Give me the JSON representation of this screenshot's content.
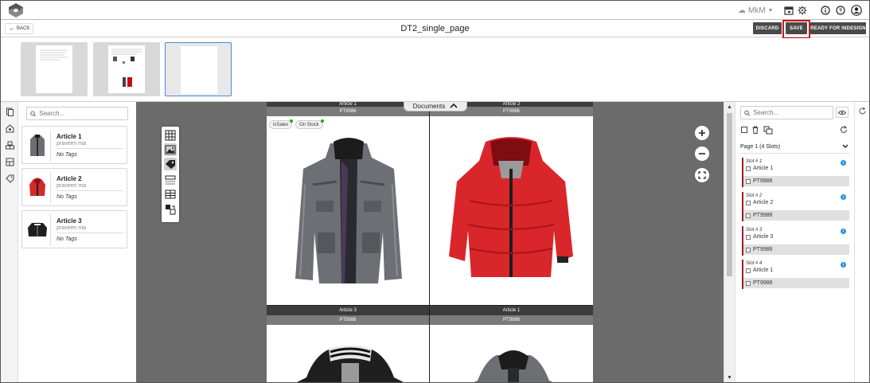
{
  "topbar": {
    "user": "MkM"
  },
  "titlebar": {
    "back_label": "BACK",
    "title": "DT2_single_page",
    "discard_label": "DISCARD",
    "save_label": "SAVE",
    "ready_label": "READY FOR INDESIGN"
  },
  "articles_panel": {
    "search_placeholder": "Search...",
    "items": [
      {
        "name": "Article 1",
        "owner": "praveen ma",
        "tags": "No Tags"
      },
      {
        "name": "Article 2",
        "owner": "praveen ma",
        "tags": "No Tags"
      },
      {
        "name": "Article 3",
        "owner": "praveen ma",
        "tags": "No Tags"
      }
    ]
  },
  "canvas": {
    "documents_label": "Documents",
    "slots": [
      {
        "header": "Article 1",
        "code": "PT9986"
      },
      {
        "header": "Article 2",
        "code": "PT9986"
      },
      {
        "header": "Article 3",
        "code": "PT9986"
      },
      {
        "header": "Article 1",
        "code": "PT9986"
      }
    ],
    "tags": [
      "isSales",
      "On Stock"
    ]
  },
  "slots_panel": {
    "search_placeholder": "Search...",
    "page_label": "Page 1 (4 Slots)",
    "slots": [
      {
        "label": "Slot # 1",
        "article": "Article 1",
        "code": "PT9986"
      },
      {
        "label": "Slot # 2",
        "article": "Article 2",
        "code": "PT9986"
      },
      {
        "label": "Slot # 3",
        "article": "Article 3",
        "code": "PT9986"
      },
      {
        "label": "Slot # 4",
        "article": "Article 1",
        "code": "PT9986"
      }
    ]
  },
  "colors": {
    "accent_red": "#d0161c",
    "slot_marker": "#9b1d2a",
    "info_blue": "#2f8fe0",
    "tag_dot": "#2ca02c"
  }
}
